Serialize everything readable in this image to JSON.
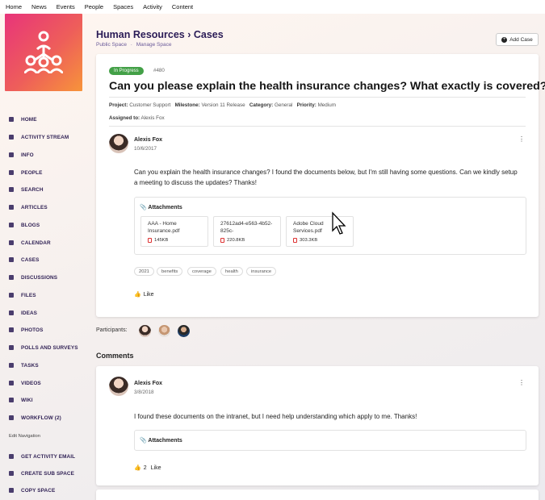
{
  "topnav": [
    "Home",
    "News",
    "Events",
    "People",
    "Spaces",
    "Activity",
    "Content"
  ],
  "sidebar": {
    "items": [
      {
        "label": "HOME",
        "icon": "home-icon"
      },
      {
        "label": "ACTIVITY STREAM",
        "icon": "list-icon"
      },
      {
        "label": "INFO",
        "icon": "info-icon"
      },
      {
        "label": "PEOPLE",
        "icon": "people-icon"
      },
      {
        "label": "SEARCH",
        "icon": "search-icon"
      },
      {
        "label": "ARTICLES",
        "icon": "article-icon"
      },
      {
        "label": "BLOGS",
        "icon": "blog-icon"
      },
      {
        "label": "CALENDAR",
        "icon": "calendar-icon"
      },
      {
        "label": "CASES",
        "icon": "cases-icon"
      },
      {
        "label": "DISCUSSIONS",
        "icon": "discussion-icon"
      },
      {
        "label": "FILES",
        "icon": "folder-icon"
      },
      {
        "label": "IDEAS",
        "icon": "lightbulb-icon"
      },
      {
        "label": "PHOTOS",
        "icon": "photo-icon"
      },
      {
        "label": "POLLS AND SURVEYS",
        "icon": "poll-icon"
      },
      {
        "label": "TASKS",
        "icon": "tasks-icon"
      },
      {
        "label": "VIDEOS",
        "icon": "video-icon"
      },
      {
        "label": "WIKI",
        "icon": "wiki-icon"
      },
      {
        "label": "WORKFLOW (2)",
        "icon": "workflow-icon"
      }
    ],
    "edit_nav": "Edit Navigation",
    "actions": [
      {
        "label": "GET ACTIVITY EMAIL",
        "icon": "email-icon"
      },
      {
        "label": "CREATE SUB SPACE",
        "icon": "sitemap-icon"
      },
      {
        "label": "COPY SPACE",
        "icon": "copy-icon"
      }
    ]
  },
  "header": {
    "title": "Human Resources › Cases",
    "sub_public": "Public Space",
    "sub_sep": "·",
    "sub_manage": "Manage Space",
    "add_case": "Add Case"
  },
  "case": {
    "status": "In Progress",
    "status_color": "#43a047",
    "number": "#480",
    "title": "Can you please explain the health insurance changes? What exactly is covered?",
    "project_label": "Project:",
    "project": "Customer Support",
    "milestone_label": "Milestone:",
    "milestone": "Version 11 Release",
    "category_label": "Category:",
    "category": "General",
    "priority_label": "Priority:",
    "priority": "Medium",
    "assigned_label": "Assigned to:",
    "assigned": "Alexis Fox"
  },
  "post": {
    "author": "Alexis Fox",
    "date": "10/6/2017",
    "text": "Can you explain the health insurance changes? I found the documents below, but I'm still having some questions. Can we kindly setup a meeting to discuss the updates? Thanks!",
    "attachments_title": "Attachments",
    "files": [
      {
        "name": "AAA - Home Insurance.pdf",
        "size": "145KB"
      },
      {
        "name": "27612ad4-e563-4b52-825c-",
        "size": "220.8KB"
      },
      {
        "name": "Adobe Cloud Services.pdf",
        "size": "303.3KB"
      }
    ],
    "tags": [
      "2021",
      "benefits",
      "coverage",
      "health",
      "insurance"
    ],
    "like_label": "Like"
  },
  "participants_label": "Participants:",
  "comments_title": "Comments",
  "comment": {
    "author": "Alexis Fox",
    "date": "3/8/2018",
    "text": "I found these documents on the intranet, but I need help understanding which apply to me. Thanks!",
    "attachments_title": "Attachments",
    "like_count": "2",
    "like_label": "Like"
  }
}
